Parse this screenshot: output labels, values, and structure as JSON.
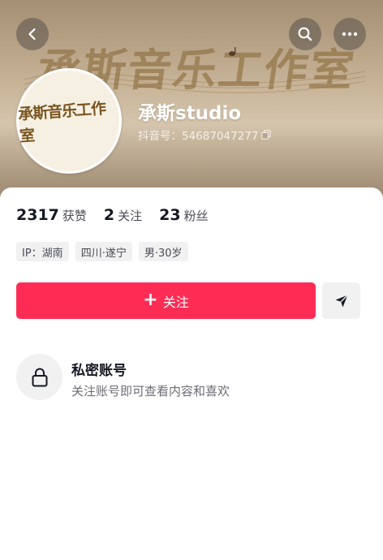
{
  "banner": {
    "art_text": "承斯音乐工作室"
  },
  "nav": {
    "back_icon": "chevron-left-icon",
    "search_icon": "search-icon",
    "more_icon": "more-horizontal-icon"
  },
  "profile": {
    "avatar_text": "承斯音乐工作室",
    "nickname": "承斯studio",
    "douyin_id": "抖音号：54687047277",
    "copy_icon": "copy-icon"
  },
  "stats": [
    {
      "value": "2317",
      "label": "获赞"
    },
    {
      "value": "2",
      "label": "关注"
    },
    {
      "value": "23",
      "label": "粉丝"
    }
  ],
  "tags": [
    "IP：湖南",
    "四川·遂宁",
    "男·30岁"
  ],
  "actions": {
    "follow_label": "关注",
    "follow_icon": "plus-icon",
    "share_icon": "send-icon",
    "accent_color": "#fe2c55"
  },
  "private_account": {
    "icon": "lock-icon",
    "title": "私密账号",
    "subtitle": "关注账号即可查看内容和喜欢"
  }
}
